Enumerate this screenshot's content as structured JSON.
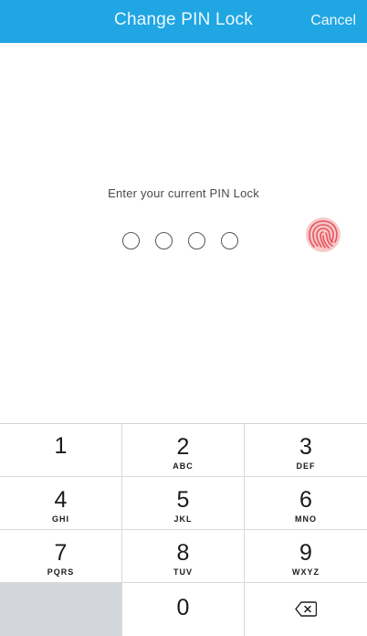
{
  "header": {
    "title": "Change PIN Lock",
    "cancel_label": "Cancel",
    "background": "#1fa6e3"
  },
  "prompt": {
    "text": "Enter your current PIN Lock",
    "pin_length": 4,
    "entered": 0
  },
  "fingerprint": {
    "icon": "fingerprint-icon",
    "color": "#e8555b"
  },
  "keypad": {
    "keys": [
      {
        "number": "1",
        "letters": ""
      },
      {
        "number": "2",
        "letters": "ABC"
      },
      {
        "number": "3",
        "letters": "DEF"
      },
      {
        "number": "4",
        "letters": "GHI"
      },
      {
        "number": "5",
        "letters": "JKL"
      },
      {
        "number": "6",
        "letters": "MNO"
      },
      {
        "number": "7",
        "letters": "PQRS"
      },
      {
        "number": "8",
        "letters": "TUV"
      },
      {
        "number": "9",
        "letters": "WXYZ"
      },
      {
        "number": "",
        "letters": ""
      },
      {
        "number": "0",
        "letters": ""
      },
      {
        "number": "",
        "letters": ""
      }
    ],
    "delete_icon": "backspace-icon"
  }
}
